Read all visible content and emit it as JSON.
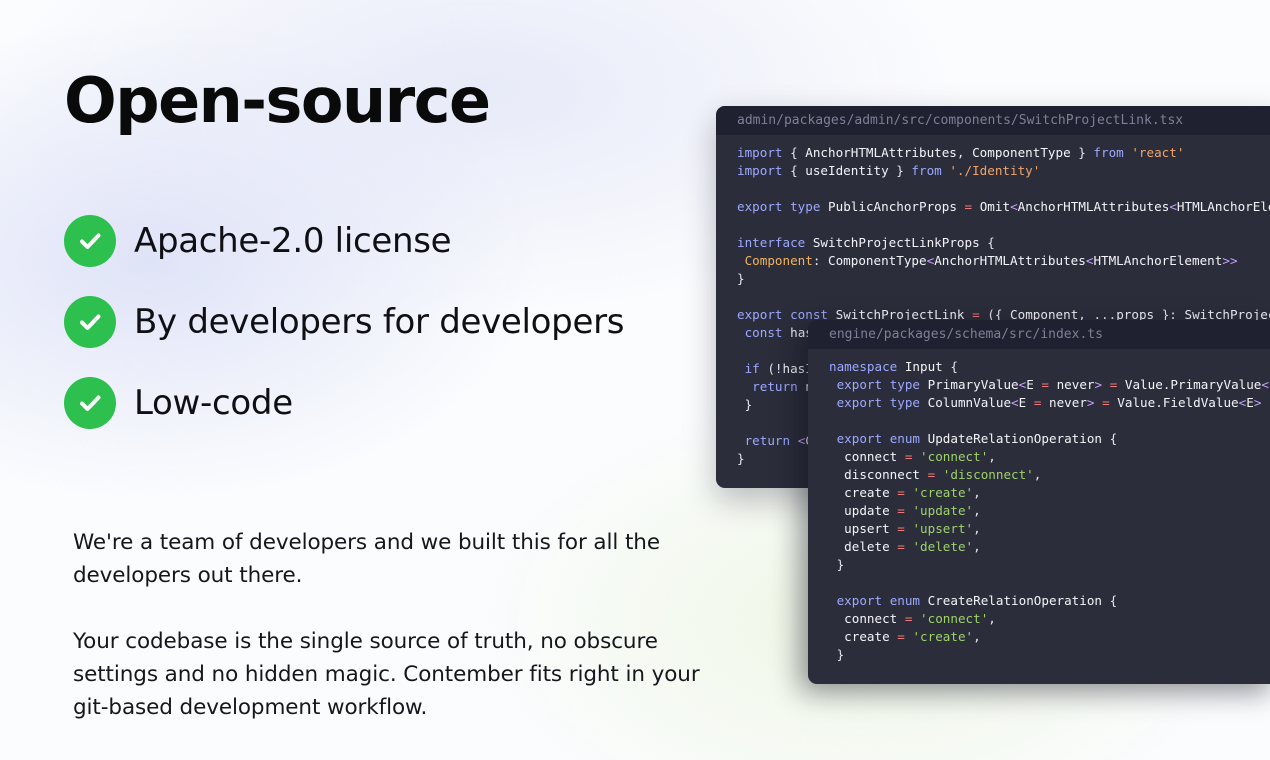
{
  "heading": "Open-source",
  "features": [
    {
      "label": "Apache-2.0 license",
      "icon": "check-circle-icon"
    },
    {
      "label": "By developers for developers",
      "icon": "check-circle-icon"
    },
    {
      "label": "Low-code",
      "icon": "check-circle-icon"
    }
  ],
  "description": [
    "We're a team of developers and we built this for all the developers out there.",
    "Your codebase is the single source of truth, no obscure settings and no hidden magic. Contember fits right in your git-based development workflow."
  ],
  "code_window_1": {
    "path": "admin/packages/admin/src/components/SwitchProjectLink.tsx",
    "lines": [
      "import { AnchorHTMLAttributes, ComponentType } from 'react'",
      "import { useIdentity } from './Identity'",
      "",
      "export type PublicAnchorProps = Omit<AnchorHTMLAttributes<HTMLAnchorElement>, 'href'>",
      "",
      "interface SwitchProjectLinkProps {",
      " Component: ComponentType<AnchorHTMLAttributes<HTMLAnchorElement>>",
      "}",
      "",
      "export const SwitchProjectLink = ({ Component, ...props }: SwitchProjectLinkProps) => {",
      " const hasIdentity = useIdentity()",
      "",
      " if (!hasIdentity) {",
      "  return null",
      " }",
      "",
      " return <Component {...props} />",
      "}"
    ]
  },
  "code_window_2": {
    "path": "engine/packages/schema/src/index.ts",
    "lines": [
      "namespace Input {",
      " export type PrimaryValue<E = never> = Value.PrimaryValue<E>",
      " export type ColumnValue<E = never> = Value.FieldValue<E>",
      "",
      " export enum UpdateRelationOperation {",
      "  connect = 'connect',",
      "  disconnect = 'disconnect',",
      "  create = 'create',",
      "  update = 'update',",
      "  upsert = 'upsert',",
      "  delete = 'delete',",
      " }",
      "",
      " export enum CreateRelationOperation {",
      "  connect = 'connect',",
      "  create = 'create',",
      " }"
    ]
  },
  "colors": {
    "check": "#2ec04f",
    "editor_bg": "#2b2d3b",
    "editor_title_bg": "#1f2030",
    "keyword": "#9ea8ff",
    "string_orange": "#f0a46a",
    "string_green": "#9ed26a"
  }
}
